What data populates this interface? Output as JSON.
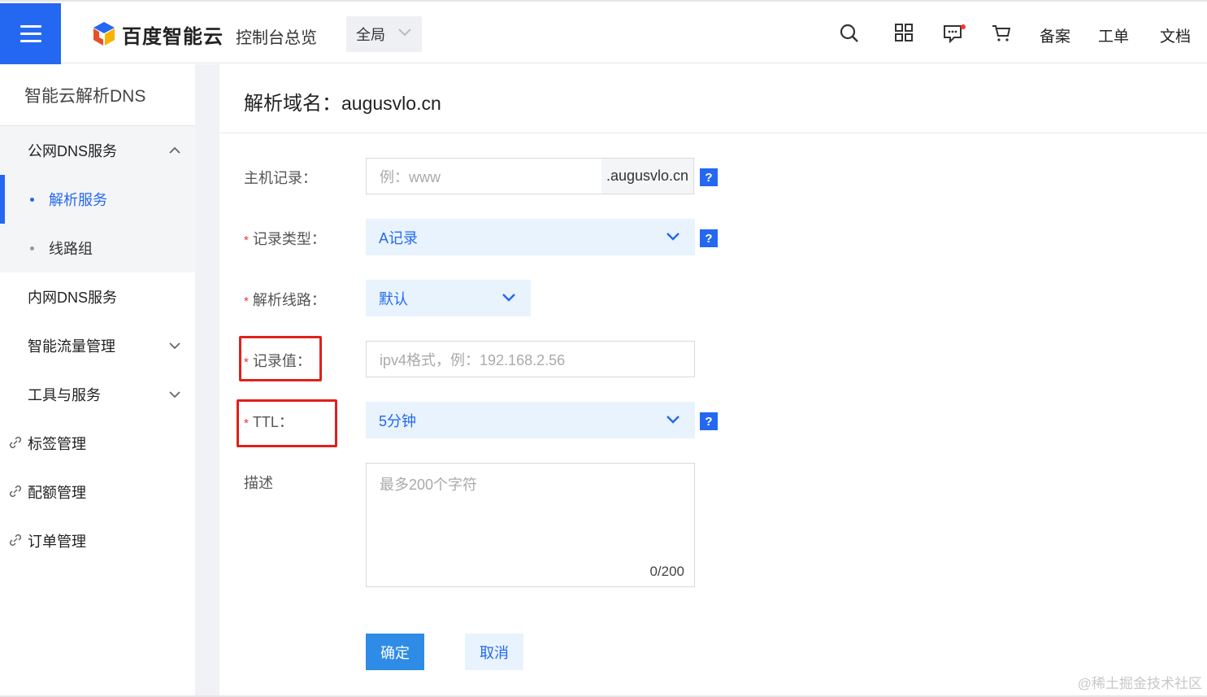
{
  "topbar": {
    "brand": "百度智能云",
    "console_link": "控制台总览",
    "scope_value": "全局",
    "links": [
      "备案",
      "工单",
      "文档"
    ],
    "icons": [
      "search-icon",
      "apps-grid-icon",
      "message-icon",
      "cart-icon"
    ],
    "accent": "#2468f2"
  },
  "sidebar": {
    "title": "智能云解析DNS",
    "groups": [
      {
        "label": "公网DNS服务",
        "expanded": true
      },
      {
        "label": "解析服务",
        "active": true
      },
      {
        "label": "线路组"
      },
      {
        "label": "内网DNS服务"
      },
      {
        "label": "智能流量管理",
        "expanded": false
      },
      {
        "label": "工具与服务",
        "expanded": false
      }
    ],
    "links": [
      "标签管理",
      "配额管理",
      "订单管理"
    ]
  },
  "main": {
    "title_prefix": "解析域名：",
    "domain": "augusvlo.cn",
    "form": {
      "host_label": "主机记录：",
      "host_placeholder": "例：www",
      "host_suffix": ".augusvlo.cn",
      "type_label": "记录类型：",
      "type_value": "A记录",
      "line_label": "解析线路：",
      "line_value": "默认",
      "value_label": "记录值：",
      "value_placeholder": "ipv4格式，例：192.168.2.56",
      "ttl_label": "TTL：",
      "ttl_value": "5分钟",
      "desc_label": "描述",
      "desc_placeholder": "最多200个字符",
      "desc_counter": "0/200",
      "required_mark": "*",
      "help_mark": "?"
    },
    "buttons": {
      "confirm": "确定",
      "cancel": "取消"
    }
  },
  "watermark": "@稀土掘金技术社区"
}
